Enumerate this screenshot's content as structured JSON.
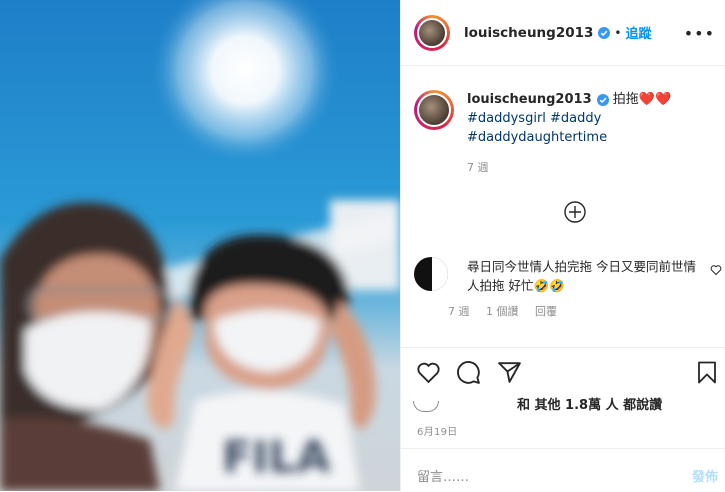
{
  "post": {
    "photo_text": "FILA",
    "username": "louischeung2013",
    "follow_label": "追蹤",
    "separator": "•",
    "more_label": "•••",
    "caption": {
      "username": "louischeung2013",
      "text": "拍拖❤️❤️",
      "hashtags_line1": "#daddysgirl #daddy",
      "hashtags_line2": "#daddydaughtertime",
      "time": "7 週"
    },
    "comment": {
      "text": "尋日同今世情人拍完拖 今日又要同前世情人拍拖 好忙🤣🤣",
      "emoji": "🤣",
      "time": "7 週",
      "likes": "1 個讚",
      "reply_label": "回覆"
    },
    "likes_text": "和 其他 1.8萬 人 都說讚",
    "date": "6月19日",
    "comment_placeholder": "留言……",
    "post_button": "發佈"
  },
  "icons": [
    "verified-badge-icon",
    "plus-circle-icon",
    "heart-icon",
    "comment-icon",
    "share-icon",
    "bookmark-icon",
    "more-icon"
  ],
  "colors": {
    "accent": "#0095f6",
    "hashtag": "#00376b",
    "muted": "#8e8e8e",
    "post_disabled": "#b2dffc"
  }
}
